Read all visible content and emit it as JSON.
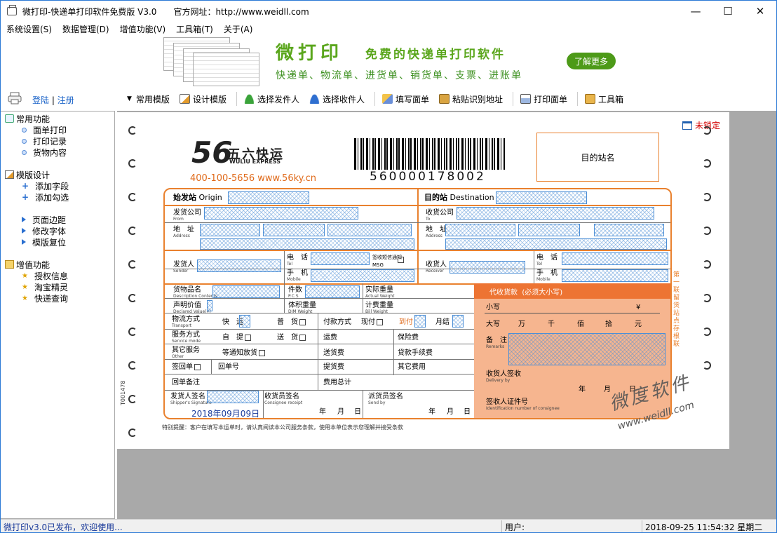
{
  "window": {
    "title": "微打印-快递单打印软件免费版 V3.0",
    "website_label": "官方网址：http://www.weidll.com",
    "controls": [
      "—",
      "☐",
      "✕"
    ]
  },
  "menu": [
    "系统设置(S)",
    "数据管理(D)",
    "增值功能(V)",
    "工具箱(T)",
    "关于(A)"
  ],
  "banner": {
    "title": "微打印",
    "subtitle": "免费的快递单打印软件",
    "line": "快递单、物流单、进货单、销货单、支票、进账单",
    "button": "了解更多"
  },
  "toolbar": {
    "login": "登陆",
    "divider": "|",
    "register": "注册",
    "items": [
      "常用模版",
      "设计模版",
      "选择发件人",
      "选择收件人",
      "填写面单",
      "粘贴识别地址",
      "打印面单",
      "工具箱"
    ]
  },
  "tree": {
    "groups": [
      {
        "label": "常用功能",
        "items": [
          "面单打印",
          "打印记录",
          "货物内容"
        ]
      },
      {
        "label": "模版设计",
        "items": [
          "添加字段",
          "添加勾选",
          "页面边距",
          "修改字体",
          "模版复位"
        ]
      },
      {
        "label": "增值功能",
        "items": [
          "授权信息",
          "淘宝精灵",
          "快递查询"
        ]
      }
    ]
  },
  "canvas": {
    "lock_label": "未锁定",
    "logo_number": "56",
    "logo_cn": "五六快运",
    "logo_en": "WULIU EXPRESS",
    "hotline": "400-100-5656  www.56ky.cn",
    "barcode_number": "560000178002",
    "station": "目的站名",
    "form": {
      "origin": "始发站",
      "origin_en": "Origin",
      "dest": "目的站",
      "dest_en": "Destination",
      "sender_co": "发货公司",
      "from_en": "From",
      "receiver_co": "收货公司",
      "to_en": "To",
      "addr": "地　址",
      "addr_en": "Address",
      "sender": "发货人",
      "sender_en": "Sender",
      "receiver": "收货人",
      "receiver_en": "Receiver",
      "tel": "电　话",
      "tel_en": "Tel",
      "mobile": "手　机",
      "mobile_en": "Mobile",
      "sms": "签收短信通知MSG",
      "goods": "货物品名",
      "goods_en": "Description Contents",
      "pcs": "件数",
      "pcs_en": "P.C.S",
      "actual_w": "实际重量",
      "actual_w_en": "Actual Weight",
      "declared": "声明价值",
      "declared_en": "Declared Value(¥)",
      "dim_w": "体积重量",
      "dim_w_en": "DIM Weight",
      "bill_w": "计费重量",
      "bill_w_en": "Bill Weight",
      "cod": "代收货款",
      "cod_note": "(必须大小写)",
      "small": "小写",
      "yen": "¥",
      "big": "大写",
      "units": [
        "万",
        "千",
        "佰",
        "拾",
        "元"
      ],
      "remarks": "备　注",
      "remarks_en": "Remarks",
      "transport": "物流方式",
      "transport_en": "Transport",
      "express": "快　运",
      "normal": "普　货",
      "pay": "付款方式",
      "cash": "现付",
      "arrive": "到付",
      "monthly": "月结",
      "service": "服务方式",
      "service_en": "Service mode",
      "self_pick": "自　提",
      "deliver": "送　货",
      "freight": "运费",
      "insurance": "保险费",
      "other": "其它服务",
      "other_en": "Other",
      "notify": "等通知放货",
      "delivery_fee": "送货费",
      "loan_fee": "贷款手续费",
      "return_slip": "签回单",
      "return_no": "回单号",
      "pickup_fee": "提货费",
      "other_fee": "其它费用",
      "return_note": "回单备注",
      "total": "费用总计",
      "delivery_sign": "收货人签收",
      "delivery_en": "Delivery by",
      "ymd": [
        "年",
        "月",
        "日"
      ],
      "id_no": "签收人证件号",
      "id_no_en": "Identification number of consignee",
      "shipper_sign": "发货人签名",
      "shipper_en": "Shipper's Signature",
      "consignee_sign": "收货员签名",
      "consignee_en": "Consignee receipt",
      "send_sign": "派货员签名",
      "send_en": "Send by",
      "date": "2018年09月09日"
    },
    "side_text": "第一联 留货站点存根联",
    "serial": "T001478",
    "note": "特别提醒：客户在填写本运单时，请认真阅读本公司服务条款，使用本单位表示您理解并接受条款",
    "watermark": "微度软件",
    "watermark_url": "www.weidll.com"
  },
  "status": {
    "message": "微打印v3.0已发布，欢迎使用...",
    "user": "用户:",
    "datetime": "2018-09-25  11:54:32  星期二"
  }
}
